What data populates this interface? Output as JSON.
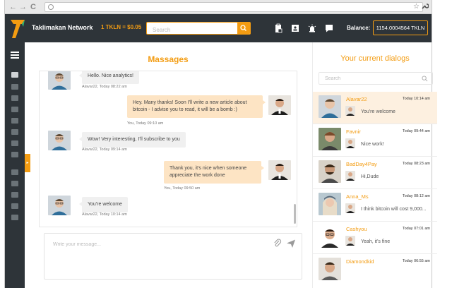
{
  "browser": {
    "back": "←",
    "forward": "→",
    "reload": "C",
    "star": "☆",
    "wrench": "🔧"
  },
  "header": {
    "brand": "Taklimakan Network",
    "rate": "1 TKLN = $0.05",
    "search_placeholder": "Search",
    "balance_label": "Balance:",
    "balance_value": "1154.0004564 TKLN",
    "accent": "#f39c12",
    "bg": "#2e3439"
  },
  "messages": {
    "title": "Massages",
    "items": [
      {
        "direction": "in",
        "text": "Hello. Nice analytics!",
        "meta": "Alavar22, Today 08:22 am"
      },
      {
        "direction": "out",
        "text_lines": [
          "Hey. Many thanks! Soon I'll write a new article about",
          "bitcoin - I advise you to read, it will be a bomb :)"
        ],
        "meta": "You, Today 09:10 am"
      },
      {
        "direction": "in",
        "text": "Wow! Very interesting, I'll subscribe to you",
        "meta": "Alavar22, Today 09:14 am"
      },
      {
        "direction": "out",
        "text_lines": [
          "Thank you, it's nice when someone",
          "appreciate the work done"
        ],
        "meta": "You, Today 09:50 am"
      },
      {
        "direction": "in",
        "text": "You're welcome",
        "meta": "Alavar22, Today 10:14 am"
      }
    ],
    "composer_placeholder": "Write your message..."
  },
  "dialogs": {
    "title": "Your current dialogs",
    "search_placeholder": "Search",
    "items": [
      {
        "name": "Alavar22",
        "time": "Today 10:14 am",
        "preview": "You're welcome"
      },
      {
        "name": "Favnir",
        "time": "Today 09:44 am",
        "preview": "Nice work!"
      },
      {
        "name": "BadDay4Pay",
        "time": "Today 08:23 am",
        "preview": "Hi,Dude"
      },
      {
        "name": "Anna_Ms",
        "time": "Today 08:12 am",
        "preview": "I think bitcoin will cost 9,000..."
      },
      {
        "name": "Cashyou",
        "time": "Today 07:01 am",
        "preview": "Yeah, it's fine"
      },
      {
        "name": "Diamondkid",
        "time": "Today 06:55 am",
        "preview": ""
      }
    ]
  }
}
